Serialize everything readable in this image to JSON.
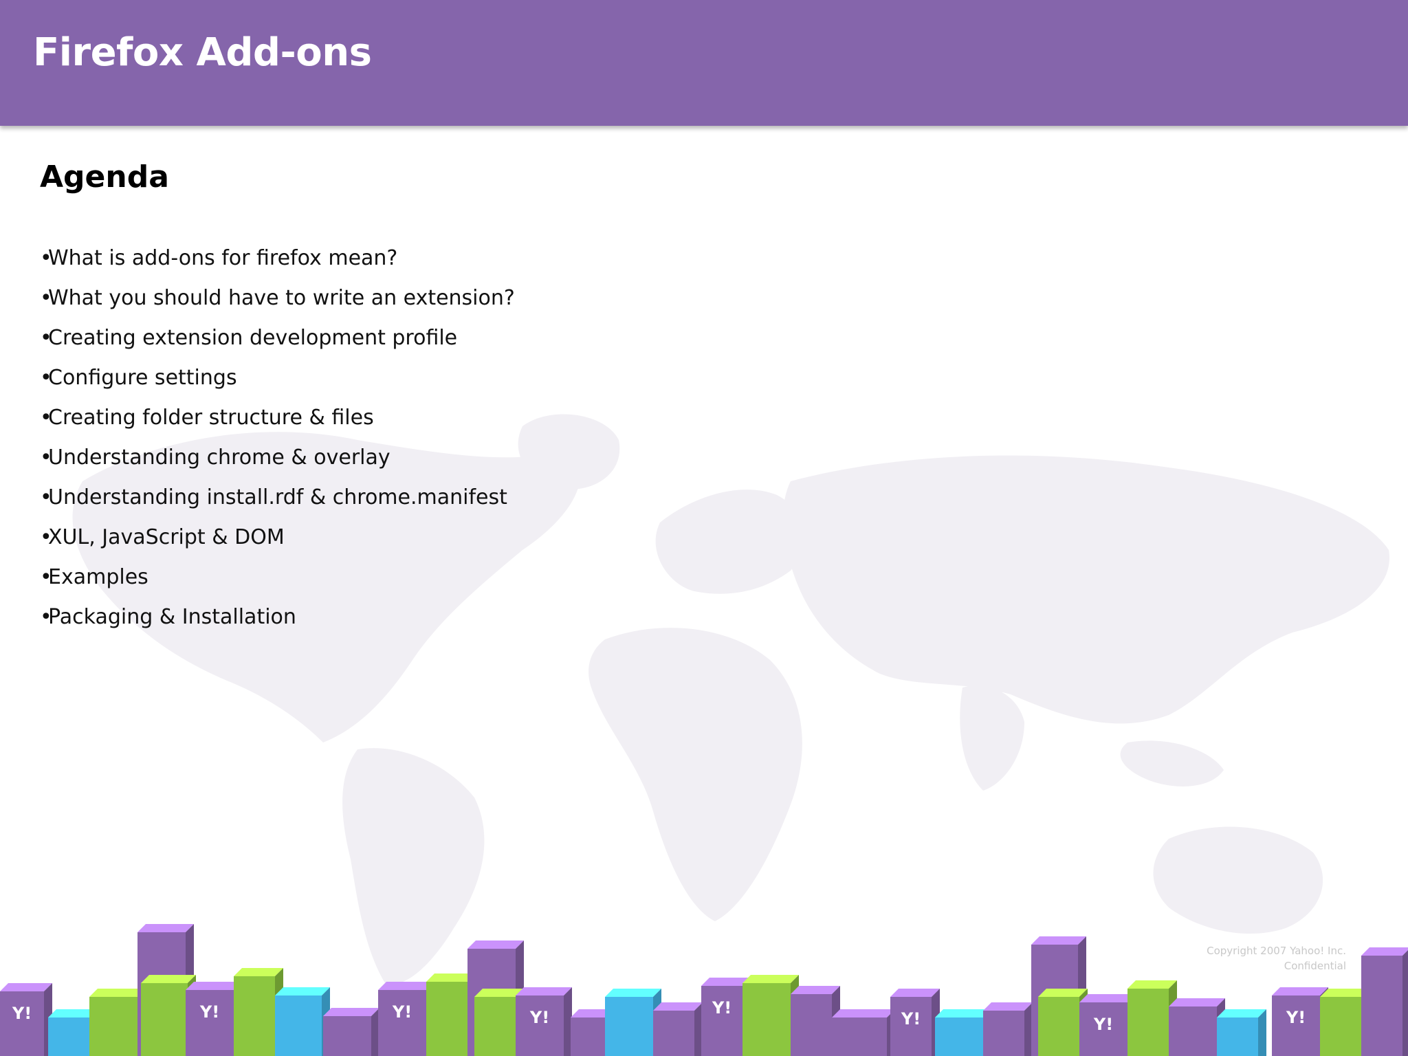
{
  "slide": {
    "title": "Firefox Add-ons",
    "heading": "Agenda",
    "bullet_char": "•",
    "items": [
      {
        "label": "What is add-ons for firefox mean?"
      },
      {
        "label": "What you should have to write an extension?"
      },
      {
        "label": "Creating extension development profile"
      },
      {
        "label": "Configure settings"
      },
      {
        "label": "Creating folder structure & files"
      },
      {
        "label": "Understanding chrome & overlay"
      },
      {
        "label": "Understanding install.rdf & chrome.manifest"
      },
      {
        "label": "XUL, JavaScript & DOM"
      },
      {
        "label": "Examples"
      },
      {
        "label": "Packaging & Installation"
      }
    ],
    "footer": {
      "copyright": "Copyright 2007 Yahoo! Inc.",
      "confidential": "Confidential"
    },
    "logo_text": "Y!"
  },
  "colors": {
    "header": "#8565ab",
    "block_purple": "#8b65ad",
    "block_green": "#8cc63f",
    "block_blue": "#44b6e8",
    "block_yellow": "#f6c51b",
    "map": "#f1eff4"
  }
}
